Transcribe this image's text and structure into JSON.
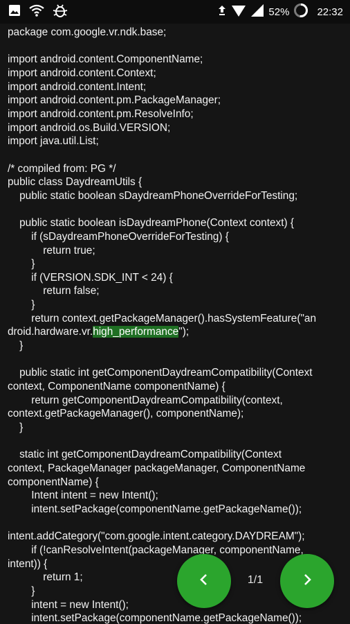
{
  "status_bar": {
    "battery_percent": "52%",
    "time": "22:32",
    "icons": [
      "image-icon",
      "wifi-icon",
      "bug-icon",
      "notification-icon",
      "signal-icon",
      "signal-2-icon",
      "battery-ring-icon"
    ]
  },
  "code": {
    "lines": [
      "package com.google.vr.ndk.base;",
      "",
      "import android.content.ComponentName;",
      "import android.content.Context;",
      "import android.content.Intent;",
      "import android.content.pm.PackageManager;",
      "import android.content.pm.ResolveInfo;",
      "import android.os.Build.VERSION;",
      "import java.util.List;",
      "",
      "/* compiled from: PG */",
      "public class DaydreamUtils {",
      "    public static boolean sDaydreamPhoneOverrideForTesting;",
      "",
      "    public static boolean isDaydreamPhone(Context context) {",
      "        if (sDaydreamPhoneOverrideForTesting) {",
      "            return true;",
      "        }",
      "        if (VERSION.SDK_INT < 24) {",
      "            return false;",
      "        }",
      "        return context.getPackageManager().hasSystemFeature(\"an",
      "droid.hardware.vr.high_performance\");",
      "    }",
      "",
      "    public static int getComponentDaydreamCompatibility(Context",
      "context, ComponentName componentName) {",
      "        return getComponentDaydreamCompatibility(context,",
      "context.getPackageManager(), componentName);",
      "    }",
      "",
      "    static int getComponentDaydreamCompatibility(Context",
      "context, PackageManager packageManager, ComponentName",
      "componentName) {",
      "        Intent intent = new Intent();",
      "        intent.setPackage(componentName.getPackageName());",
      "",
      "intent.addCategory(\"com.google.intent.category.DAYDREAM\");",
      "        if (!canResolveIntent(packageManager, componentName,",
      "intent)) {",
      "            return 1;",
      "        }",
      "        intent = new Intent();",
      "        intent.setPackage(componentName.getPackageName());"
    ],
    "highlight": {
      "line_index": 22,
      "text": "high_performance",
      "color": "#1f6f23"
    }
  },
  "pager": {
    "label": "1/1",
    "prev_icon": "chevron-left-icon",
    "next_icon": "chevron-right-icon",
    "accent_color": "#2ba52d"
  }
}
